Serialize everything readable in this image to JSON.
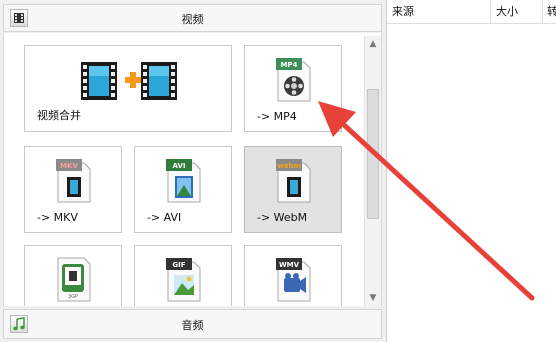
{
  "video_category": {
    "label": "视频"
  },
  "audio_category": {
    "label": "音频"
  },
  "tiles": [
    {
      "label": "视频合并",
      "icon": "video-merge-icon"
    },
    {
      "label": "-> MP4",
      "badge": "MP4",
      "icon": "mp4-file-icon"
    },
    {
      "label": "-> MKV",
      "badge": "MKV",
      "icon": "mkv-file-icon"
    },
    {
      "label": "-> AVI",
      "badge": "AVI",
      "icon": "avi-file-icon"
    },
    {
      "label": "-> WebM",
      "badge": "webm",
      "icon": "webm-file-icon"
    },
    {
      "badge": "3GP",
      "icon": "3gp-file-icon"
    },
    {
      "badge": "GIF",
      "icon": "gif-file-icon"
    },
    {
      "badge": "WMV",
      "icon": "wmv-file-icon"
    }
  ],
  "table": {
    "columns": [
      "来源",
      "大小",
      "转"
    ]
  },
  "colors": {
    "arrow": "#e8413a",
    "selected_tile": "#e2e2e2",
    "film_green": "#2aa54a"
  }
}
